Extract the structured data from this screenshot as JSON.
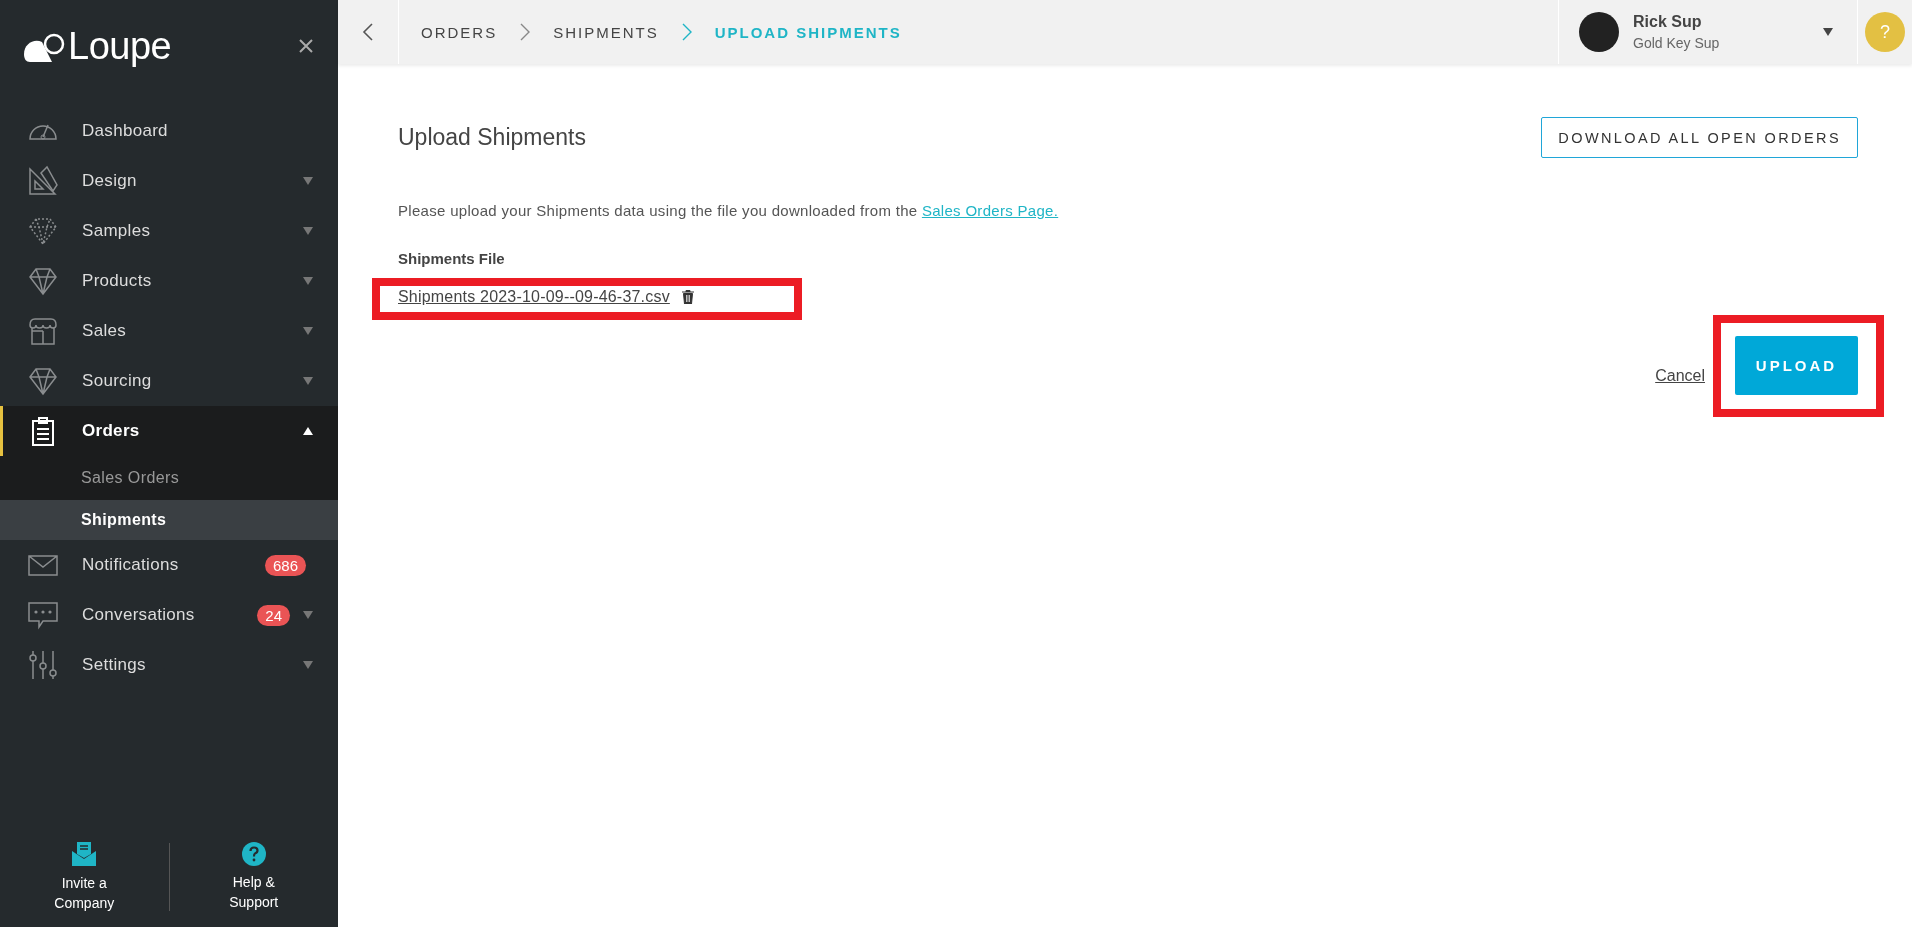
{
  "sidebar": {
    "logo": "Loupe",
    "items": [
      {
        "label": "Dashboard",
        "kind": "plain",
        "selected": false
      },
      {
        "label": "Design",
        "kind": "group",
        "expanded": false,
        "selected": false
      },
      {
        "label": "Samples",
        "kind": "group",
        "expanded": false,
        "selected": false
      },
      {
        "label": "Products",
        "kind": "group",
        "expanded": false,
        "selected": false
      },
      {
        "label": "Sales",
        "kind": "group",
        "expanded": false,
        "selected": false
      },
      {
        "label": "Sourcing",
        "kind": "group",
        "expanded": false,
        "selected": false
      },
      {
        "label": "Orders",
        "kind": "group",
        "expanded": true,
        "selected": true,
        "children": [
          {
            "label": "Sales Orders",
            "selected": false
          },
          {
            "label": "Shipments",
            "selected": true
          }
        ]
      },
      {
        "label": "Notifications",
        "kind": "plain",
        "selected": false,
        "badge": "686"
      },
      {
        "label": "Conversations",
        "kind": "group",
        "expanded": false,
        "selected": false,
        "badge": "24"
      },
      {
        "label": "Settings",
        "kind": "group",
        "expanded": false,
        "selected": false
      }
    ],
    "footer": [
      {
        "label": "Invite a Company"
      },
      {
        "label": "Help & Support"
      }
    ]
  },
  "breadcrumbs": [
    {
      "label": "ORDERS",
      "selected": false
    },
    {
      "label": "SHIPMENTS",
      "selected": false
    },
    {
      "label": "UPLOAD SHIPMENTS",
      "selected": true
    }
  ],
  "user": {
    "name": "Rick Sup",
    "company": "Gold Key Sup"
  },
  "help_button": "?",
  "page": {
    "title": "Upload Shipments",
    "download_button": "DOWNLOAD ALL OPEN ORDERS",
    "description": "Please upload your Shipments data using the file you downloaded from the",
    "description_link": "Sales Orders Page.",
    "file_label": "Shipments File",
    "file_name": "Shipments 2023-10-09--09-46-37.csv",
    "file_highlighted": true,
    "cancel": "Cancel",
    "upload_button": "UPLOAD",
    "upload_highlighted": true
  }
}
